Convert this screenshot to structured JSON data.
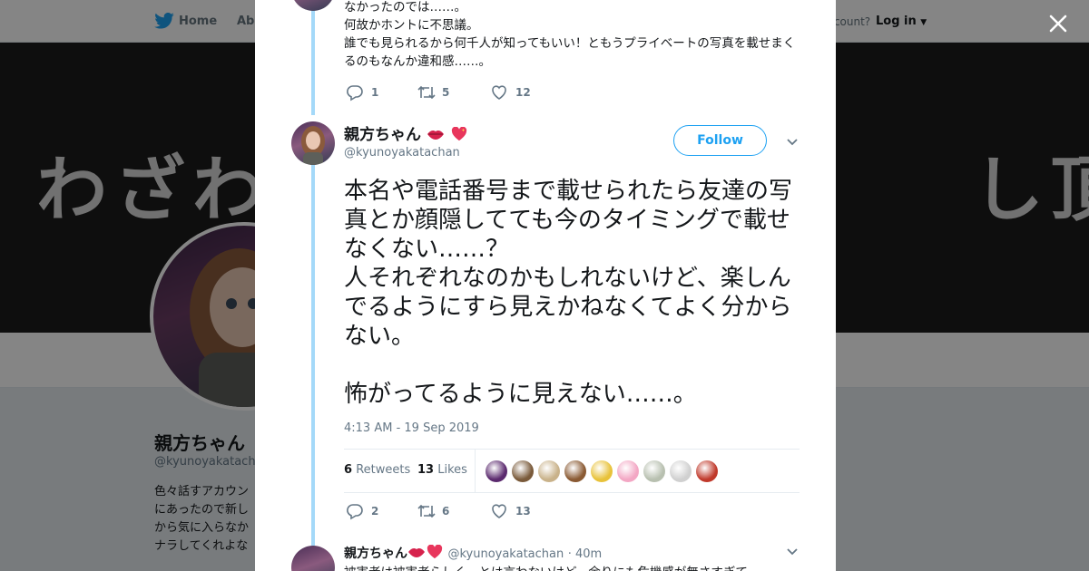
{
  "nav": {
    "home": "Home",
    "about": "Abo",
    "account_prompt": "account?",
    "login": "Log in"
  },
  "banner": {
    "text": "わざわ　　　　　　　　　し頂き"
  },
  "profile": {
    "name": "親方ちゃん",
    "handle": "@kyunoyakatach",
    "bio": "色々話すアカウン\nにあったので新し\nから気に入らなか\nナラしてくれよな"
  },
  "previous_tweet": {
    "text": "なかったのでは……。\n何故かホントに不思議。\n誰でも見られるから何千人が知ってもいい！ともうプライベートの写真を載せまくるのもなんか違和感……。",
    "replies": "1",
    "retweets": "5",
    "likes": "12"
  },
  "main_tweet": {
    "name": "親方ちゃん",
    "handle": "@kyunoyakatachan",
    "follow_label": "Follow",
    "text": "本名や電話番号まで載せられたら友達の写真とか顔隠してても今のタイミングで載せなくない……？\n人それぞれなのかもしれないけど、楽しんでるようにすら見えかねなくてよく分からない。\n\n怖がってるように見えない……。",
    "timestamp": "4:13 AM - 19 Sep 2019",
    "retweet_count": "6",
    "retweet_label": "Retweets",
    "like_count": "13",
    "like_label": "Likes",
    "replies": "2",
    "retweets": "6",
    "likes": "13",
    "liker_colors": [
      "#5b2a6e",
      "#7a5a3a",
      "#c9b28a",
      "#8a5a33",
      "#e8c23a",
      "#f3a7c4",
      "#b8c0b0",
      "#d0d0d0",
      "#c0392b"
    ]
  },
  "reply_tweet": {
    "name": "親方ちゃん",
    "handle": "@kyunoyakatachan",
    "time": "· 40m",
    "text": "被害者は被害者らしく…とは言わないけど、余りにも危機感が無さすぎて……"
  },
  "colors": {
    "accent": "#1da1f2",
    "thread": "#a4d9f9",
    "muted": "#657786"
  },
  "icons": [
    "twitter-bird-icon",
    "close-icon",
    "reply-icon",
    "retweet-icon",
    "like-icon",
    "chevron-down-icon",
    "lips-emoji-icon",
    "sparkling-heart-emoji-icon"
  ]
}
